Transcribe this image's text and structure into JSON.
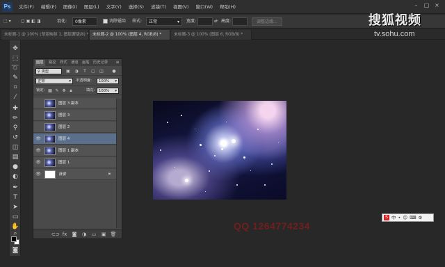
{
  "menubar": {
    "logo": "Ps",
    "items": [
      "文件(F)",
      "编辑(E)",
      "图像(I)",
      "图层(L)",
      "文字(Y)",
      "选择(S)",
      "滤镜(T)",
      "视图(V)",
      "窗口(W)",
      "帮助(H)"
    ]
  },
  "options": {
    "feather_label": "羽化:",
    "feather_value": "0像素",
    "antialias_label": "消除锯齿",
    "style_label": "样式:",
    "style_value": "正常",
    "width_label": "宽度:",
    "height_label": "高度:",
    "refine_edge": "调整边缘..."
  },
  "tabs": [
    "未标题-1 @ 100% (渐变映射 1, 图层蒙版/8) *",
    "未标题-2 @ 100% (图层 4, RGB/8) *",
    "未标题-3 @ 100% (图层 6, RGB/8) *"
  ],
  "layers_panel": {
    "tabs": [
      "图层",
      "路径",
      "样式",
      "通道",
      "画笔",
      "历史记录"
    ],
    "filter_kind": "类型",
    "blend_mode": "正常",
    "opacity_label": "不透明度:",
    "opacity_value": "100%",
    "lock_label": "锁定:",
    "fill_label": "填充:",
    "fill_value": "100%",
    "layers": [
      {
        "name": "图层 3 副本",
        "visible": false
      },
      {
        "name": "图层 3",
        "visible": false
      },
      {
        "name": "图层 2",
        "visible": false
      },
      {
        "name": "图层 4",
        "visible": true
      },
      {
        "name": "图层 1 副本",
        "visible": true
      },
      {
        "name": "图层 1",
        "visible": true
      },
      {
        "name": "背景",
        "visible": true
      }
    ]
  },
  "watermark": {
    "sohu_title": "搜狐视频",
    "sohu_url": "tv.sohu.com",
    "number": "QQ 1264774234"
  },
  "ime": {
    "logo": "S",
    "items": [
      "中",
      "•",
      "☺",
      "⌨",
      "⚙"
    ]
  }
}
